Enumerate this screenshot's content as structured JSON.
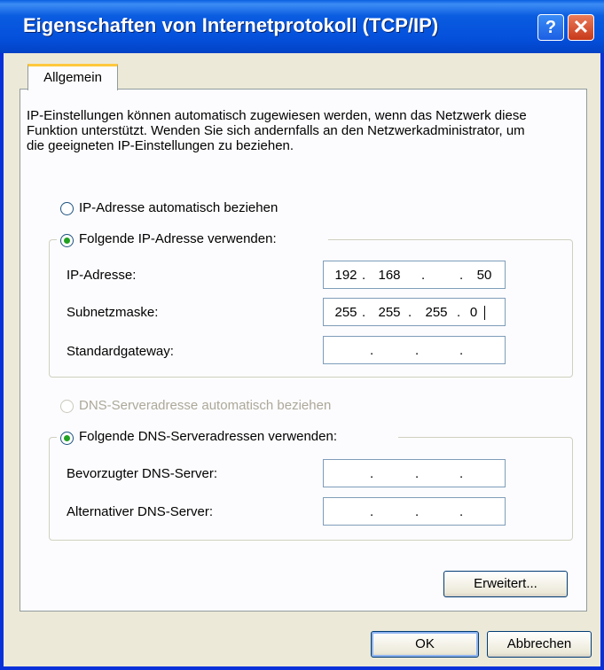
{
  "window": {
    "title": "Eigenschaften von Internetprotokoll (TCP/IP)",
    "help_icon": "?",
    "close_icon": "✕"
  },
  "tabs": [
    {
      "label": "Allgemein"
    }
  ],
  "intro_text": "IP-Einstellungen können automatisch zugewiesen werden, wenn das Netzwerk diese Funktion unterstützt. Wenden Sie sich andernfalls an den Netzwerkadministrator, um die geeigneten IP-Einstellungen zu beziehen.",
  "ip_section": {
    "auto_label": "IP-Adresse automatisch beziehen",
    "manual_label": "Folgende IP-Adresse verwenden:",
    "selected": "manual",
    "fields": [
      {
        "label": "IP-Adresse:",
        "octets": [
          "192",
          "168",
          "",
          "50"
        ]
      },
      {
        "label": "Subnetzmaske:",
        "octets": [
          "255",
          "255",
          "255",
          "0"
        ]
      },
      {
        "label": "Standardgateway:",
        "octets": [
          "",
          "",
          "",
          ""
        ]
      }
    ]
  },
  "dns_section": {
    "auto_label": "DNS-Serveradresse automatisch beziehen",
    "manual_label": "Folgende DNS-Serveradressen verwenden:",
    "selected": "manual",
    "auto_disabled": true,
    "fields": [
      {
        "label": "Bevorzugter DNS-Server:",
        "octets": [
          "",
          "",
          "",
          ""
        ]
      },
      {
        "label": "Alternativer DNS-Server:",
        "octets": [
          "",
          "",
          "",
          ""
        ]
      }
    ]
  },
  "buttons": {
    "advanced": "Erweitert...",
    "ok": "OK",
    "cancel": "Abbrechen"
  }
}
